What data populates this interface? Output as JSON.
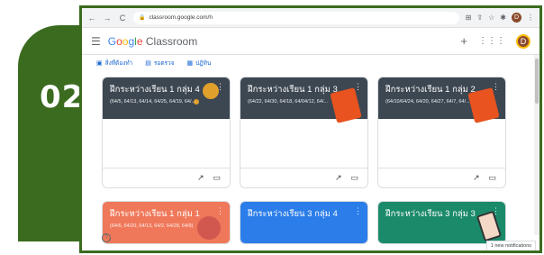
{
  "step": {
    "number": "02",
    "color": "#3b6b1f"
  },
  "browser": {
    "url": "classroom.google.com/h",
    "nav_icons": [
      "back-icon",
      "forward-icon",
      "reload-icon"
    ],
    "right_icons": [
      "translate-icon",
      "share-icon",
      "star-icon",
      "extensions-icon"
    ],
    "profile_initial": "D"
  },
  "app": {
    "title_parts": [
      "G",
      "o",
      "o",
      "g",
      "l",
      "e"
    ],
    "title_suffix": " Classroom",
    "plus_label": "+",
    "apps_icon": "apps-grid-icon",
    "avatar_initial": "D"
  },
  "shortcuts": [
    {
      "label": "สิ่งที่ต้องทำ",
      "icon": "todo-icon"
    },
    {
      "label": "รอตรวจ",
      "icon": "review-icon"
    },
    {
      "label": "ปฏิทิน",
      "icon": "calendar-icon"
    }
  ],
  "cards": [
    {
      "title": "ฝึกระหว่างเรียน 1 กลุ่ม 4",
      "sub": "(64/5, 64/13, 64/14, 64/25, 64/19, 64/...",
      "theme": "row1"
    },
    {
      "title": "ฝึกระหว่างเรียน 1 กลุ่ม 3",
      "sub": "(64/22, 64/30, 64/18, 64/04/12, 64/...",
      "theme": "row1"
    },
    {
      "title": "ฝึกระหว่างเรียน 1 กลุ่ม 2",
      "sub": "(64/10/64/24, 64/20, 64/27, 64/7, 64/...",
      "theme": "row1"
    },
    {
      "title": "ฝึกระหว่างเรียน 1 กลุ่ม 1",
      "sub": "(64/6, 64/20, 64/13, 64/2, 64/28, 64/9)",
      "theme": "orange"
    },
    {
      "title": "ฝึกระหว่างเรียน 3 กลุ่ม 4",
      "sub": "",
      "theme": "blue"
    },
    {
      "title": "ฝึกระหว่างเรียน 3 กลุ่ม 3",
      "sub": "",
      "theme": "teal"
    }
  ],
  "card_footer_icons": [
    "trending-icon",
    "folder-icon"
  ],
  "notification": "1 new notifications",
  "help_label": "?"
}
